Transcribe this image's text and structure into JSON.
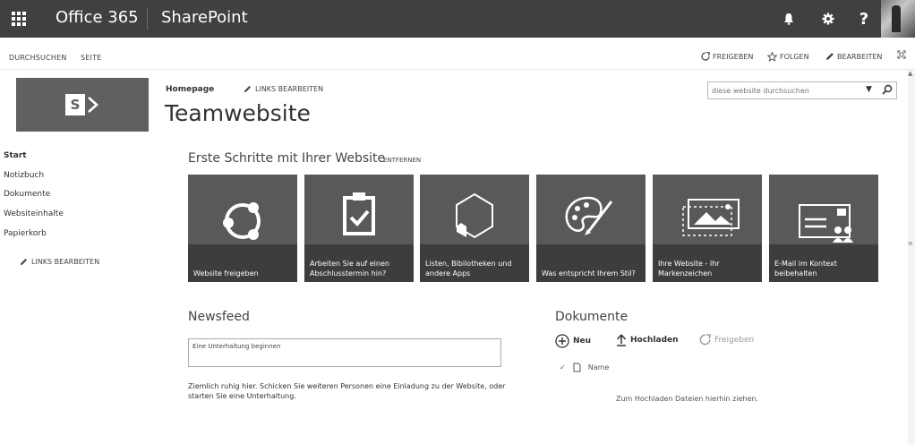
{
  "suitebar": {
    "brand": "Office 365",
    "app": "SharePoint",
    "help": "?"
  },
  "ribbon": {
    "tabs": [
      "DURCHSUCHEN",
      "SEITE"
    ],
    "share": "FREIGEBEN",
    "follow": "FOLGEN",
    "edit": "BEARBEITEN"
  },
  "logo": {
    "letter": "S"
  },
  "header": {
    "breadcrumb": "Homepage",
    "edit_links": "LINKS BEARBEITEN",
    "title": "Teamwebsite"
  },
  "search": {
    "placeholder": "diese website durchsuchen"
  },
  "nav": {
    "items": [
      "Start",
      "Notizbuch",
      "Dokumente",
      "Websiteinhalte",
      "Papierkorb"
    ],
    "edit_links": "LINKS BEARBEITEN"
  },
  "getting_started": {
    "title": "Erste Schritte mit Ihrer Website",
    "remove": "ENTFERNEN",
    "tiles": [
      {
        "label": "Website freigeben",
        "icon": "share-site-icon"
      },
      {
        "label": "Arbeiten Sie auf einen Abschlusstermin hin?",
        "icon": "clipboard-check-icon"
      },
      {
        "label": "Listen, Bibliotheken und andere Apps",
        "icon": "apps-hexagon-icon"
      },
      {
        "label": "Was entspricht Ihrem Stil?",
        "icon": "palette-brush-icon"
      },
      {
        "label": "Ihre Website - Ihr Markenzeichen",
        "icon": "picture-frame-icon"
      },
      {
        "label": "E-Mail im Kontext beibehalten",
        "icon": "mail-people-icon"
      }
    ]
  },
  "newsfeed": {
    "title": "Newsfeed",
    "placeholder": "Eine Unterhaltung beginnen",
    "message": "Ziemlich ruhig hier. Schicken Sie weiteren Personen eine Einladung zu der Website, oder starten Sie eine Unterhaltung."
  },
  "documents": {
    "title": "Dokumente",
    "new": "Neu",
    "upload": "Hochladen",
    "share": "Freigeben",
    "column_name": "Name",
    "drop_hint": "Zum Hochladen Dateien hierhin ziehen."
  },
  "colors": {
    "suitebar": "#404040",
    "tile": "#595959",
    "tile_band": "#3d3d3d",
    "logo_bg": "#606060"
  }
}
